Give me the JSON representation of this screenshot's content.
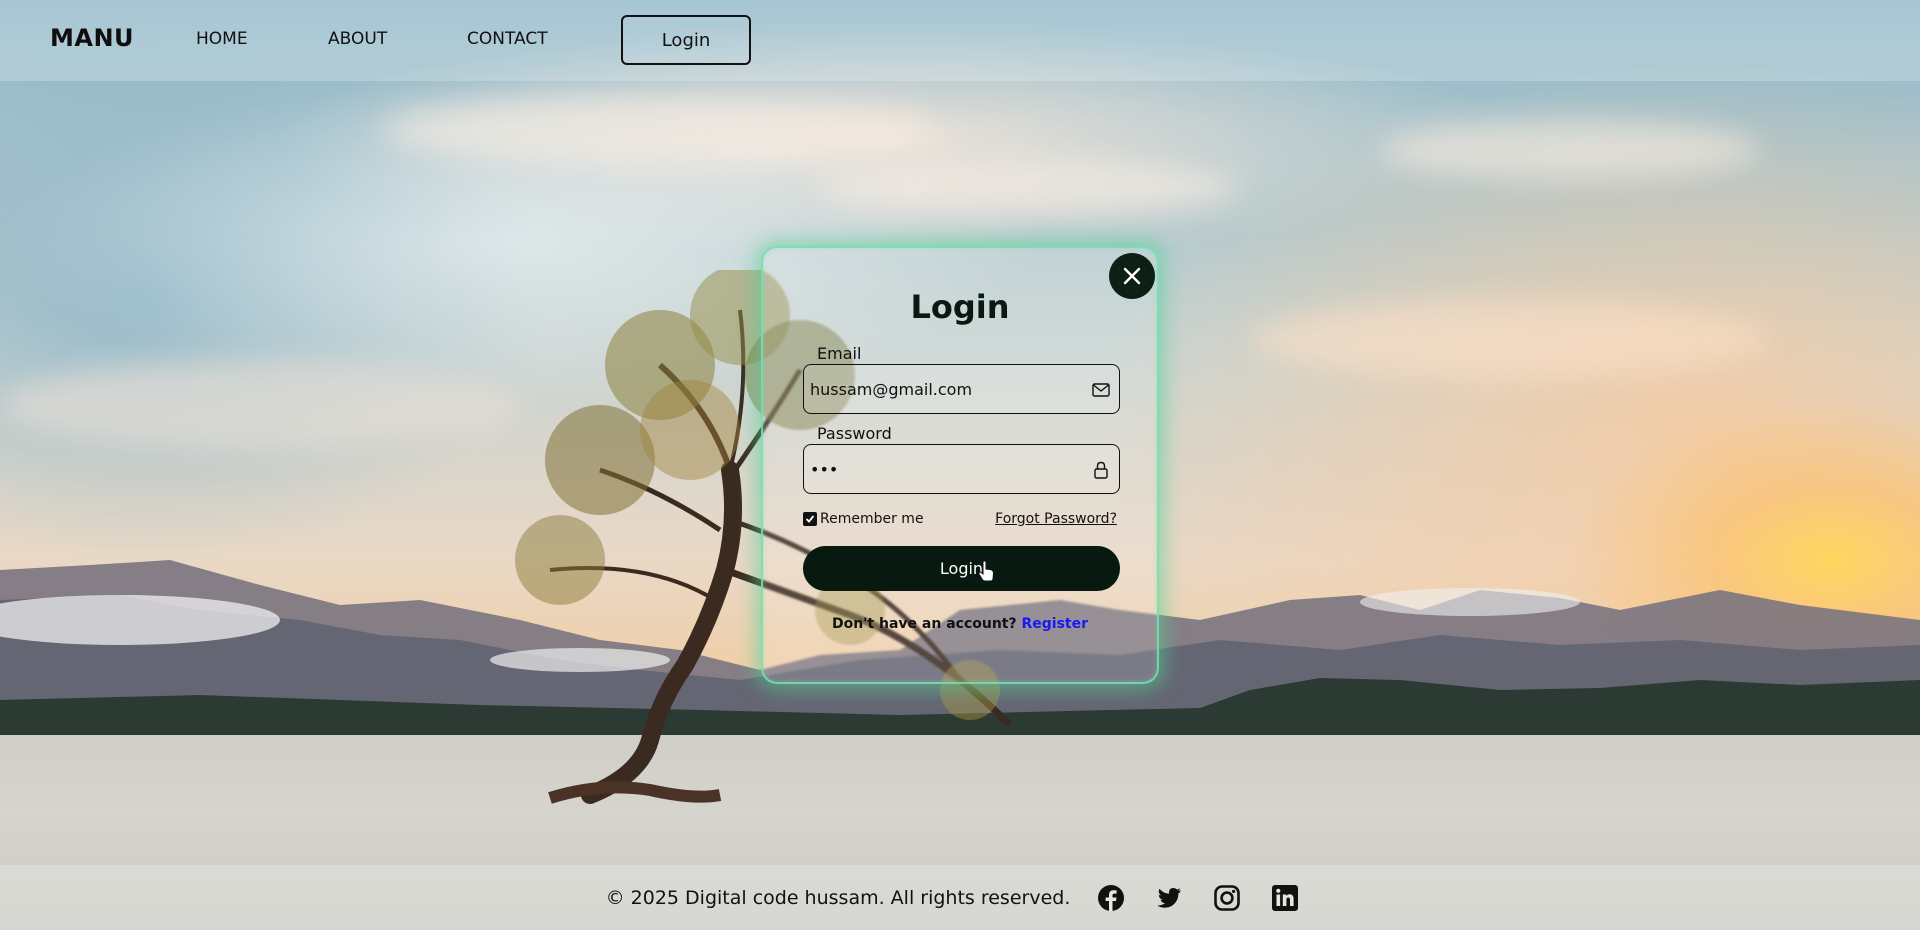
{
  "navbar": {
    "brand": "MANU",
    "links": [
      "HOME",
      "ABOUT",
      "CONTACT"
    ],
    "login_label": "Login"
  },
  "login_form": {
    "title": "Login",
    "email_label": "Email",
    "email_value": "hussam@gmail.com",
    "password_label": "Password",
    "password_value": "•••",
    "remember_label": "Remember me",
    "remember_checked": true,
    "forgot_label": "Forgot Password?",
    "submit_label": "Login",
    "register_prompt": "Don't have an account?",
    "register_label": "Register"
  },
  "footer": {
    "copyright": "© 2025 Digital code hussam. All rights reserved.",
    "social_icons": [
      "facebook-icon",
      "twitter-icon",
      "instagram-icon",
      "linkedin-icon"
    ]
  },
  "colors": {
    "card_glow": "#50d296",
    "button_dark": "#081a10",
    "register_link": "#1a1af0"
  }
}
